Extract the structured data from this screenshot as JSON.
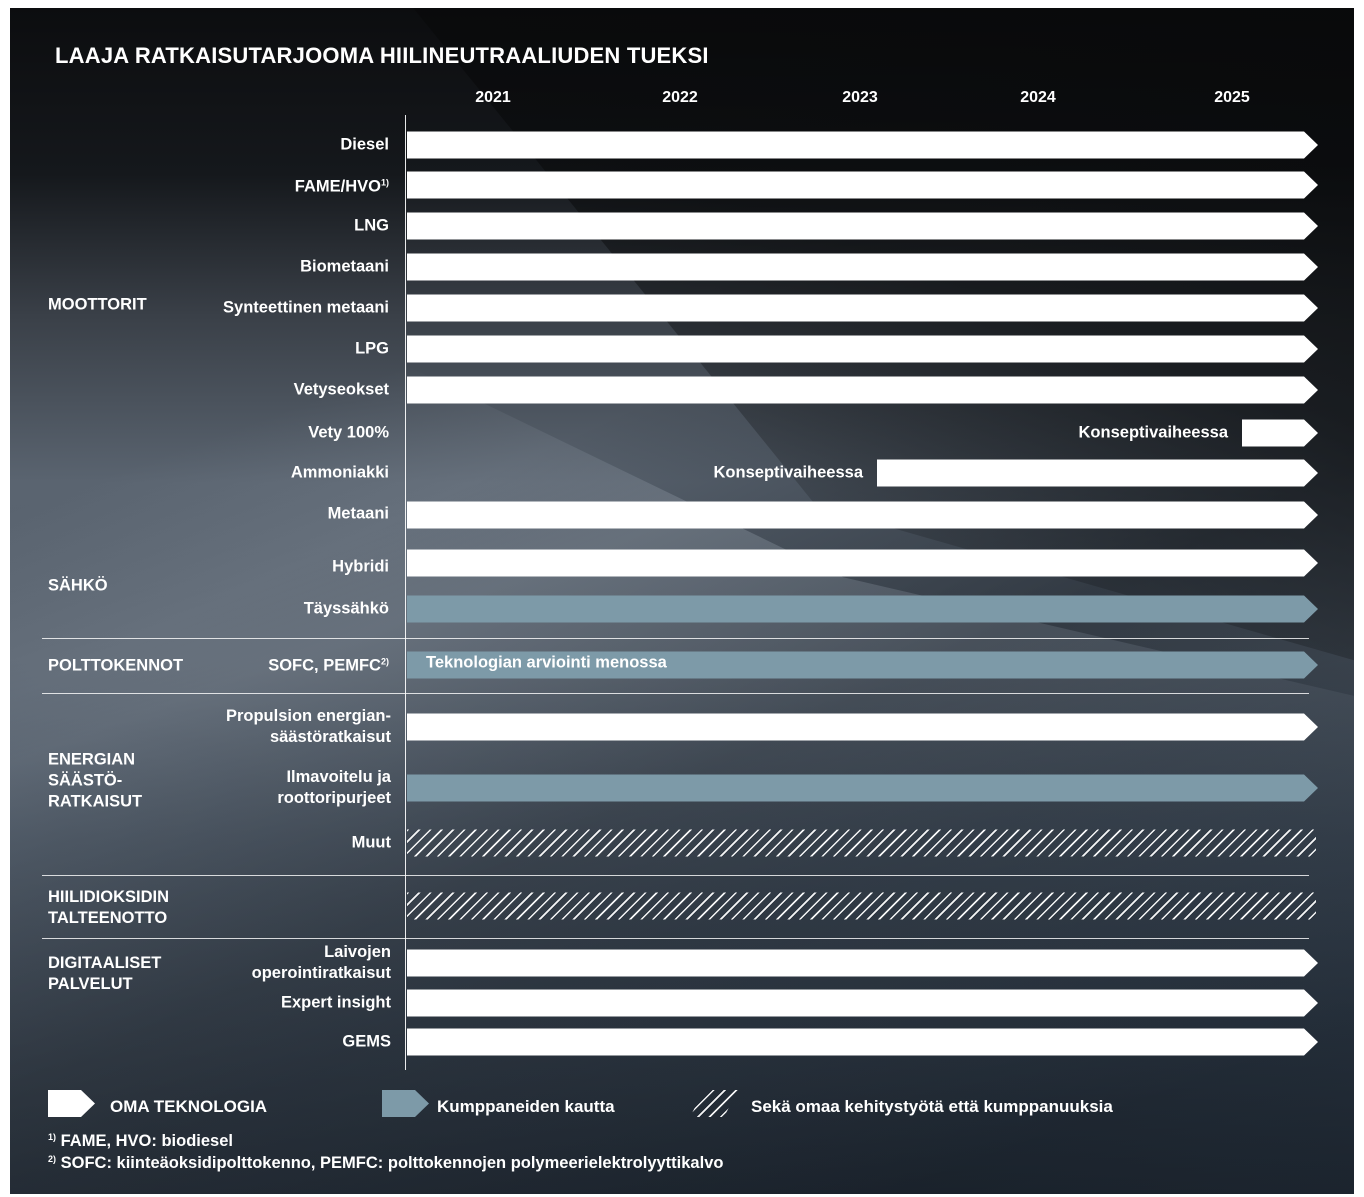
{
  "title": "LAAJA RATKAISUTARJOOMA HIILINEUTRAALIUDEN TUEKSI",
  "chart_data": {
    "type": "timeline",
    "years": [
      "2021",
      "2022",
      "2023",
      "2024",
      "2025"
    ],
    "rows": [
      {
        "id": "diesel",
        "label": "Diesel",
        "sup": "",
        "kind": "own",
        "start": 2020.5,
        "end": 2025.5,
        "bar_label": ""
      },
      {
        "id": "fame",
        "label": "FAME/HVO",
        "sup": "1)",
        "kind": "own",
        "start": 2020.5,
        "end": 2025.5,
        "bar_label": ""
      },
      {
        "id": "lng",
        "label": "LNG",
        "sup": "",
        "kind": "own",
        "start": 2020.5,
        "end": 2025.5,
        "bar_label": ""
      },
      {
        "id": "biomethane",
        "label": "Biometaani",
        "sup": "",
        "kind": "own",
        "start": 2020.5,
        "end": 2025.5,
        "bar_label": ""
      },
      {
        "id": "synmethane",
        "label": "Synteettinen metaani",
        "sup": "",
        "kind": "own",
        "start": 2020.5,
        "end": 2025.5,
        "bar_label": ""
      },
      {
        "id": "lpg",
        "label": "LPG",
        "sup": "",
        "kind": "own",
        "start": 2020.5,
        "end": 2025.5,
        "bar_label": ""
      },
      {
        "id": "h2blend",
        "label": "Vetyseokset",
        "sup": "",
        "kind": "own",
        "start": 2020.5,
        "end": 2025.5,
        "bar_label": ""
      },
      {
        "id": "h2full",
        "label": "Vety 100%",
        "sup": "",
        "kind": "own",
        "start": 2025.0,
        "end": 2025.5,
        "bar_label": "Konseptivaiheessa"
      },
      {
        "id": "ammonia",
        "label": "Ammoniakki",
        "sup": "",
        "kind": "own",
        "start": 2023.05,
        "end": 2025.5,
        "bar_label": "Konseptivaiheessa"
      },
      {
        "id": "methane",
        "label": "Metaani",
        "sup": "",
        "kind": "own",
        "start": 2020.5,
        "end": 2025.5,
        "bar_label": ""
      },
      {
        "id": "hybrid",
        "label": "Hybridi",
        "sup": "",
        "kind": "own",
        "start": 2020.5,
        "end": 2025.5,
        "bar_label": ""
      },
      {
        "id": "fullelec",
        "label": "Täyssähkö",
        "sup": "",
        "kind": "partner",
        "start": 2020.5,
        "end": 2025.5,
        "bar_label": ""
      },
      {
        "id": "sofc",
        "label": "SOFC, PEMFC",
        "sup": "2)",
        "kind": "partner",
        "start": 2020.5,
        "end": 2025.5,
        "bar_label": "Teknologian arviointi menossa"
      },
      {
        "id": "propulsion",
        "label": [
          "Propulsion energian-",
          "säästöratkaisut"
        ],
        "sup": "",
        "kind": "own",
        "start": 2020.5,
        "end": 2025.5,
        "bar_label": ""
      },
      {
        "id": "airlub",
        "label": [
          "Ilmavoitelu ja",
          "roottoripurjeet"
        ],
        "sup": "",
        "kind": "partner",
        "start": 2020.5,
        "end": 2025.5,
        "bar_label": ""
      },
      {
        "id": "other",
        "label": "Muut",
        "sup": "",
        "kind": "both",
        "start": 2020.5,
        "end": 2025.5,
        "bar_label": ""
      },
      {
        "id": "ccs",
        "label": "",
        "sup": "",
        "kind": "both",
        "start": 2020.5,
        "end": 2025.5,
        "bar_label": ""
      },
      {
        "id": "vesselops",
        "label": [
          "Laivojen",
          "operointiratkaisut"
        ],
        "sup": "",
        "kind": "own",
        "start": 2020.5,
        "end": 2025.5,
        "bar_label": ""
      },
      {
        "id": "expert",
        "label": "Expert insight",
        "sup": "",
        "kind": "own",
        "start": 2020.5,
        "end": 2025.5,
        "bar_label": ""
      },
      {
        "id": "gems",
        "label": "GEMS",
        "sup": "",
        "kind": "own",
        "start": 2020.5,
        "end": 2025.5,
        "bar_label": ""
      }
    ],
    "groups": [
      {
        "id": "engines",
        "label": [
          "MOOTTORIT"
        ]
      },
      {
        "id": "electric",
        "label": [
          "SÄHKÖ"
        ]
      },
      {
        "id": "fuelcells",
        "label": [
          "POLTTOKENNOT"
        ]
      },
      {
        "id": "energysaving",
        "label": [
          "ENERGIAN",
          "SÄÄSTÖ-",
          "RATKAISUT"
        ]
      },
      {
        "id": "ccs",
        "label": [
          "HIILIDIOKSIDIN",
          "TALTEENOTTO"
        ]
      },
      {
        "id": "digital",
        "label": [
          "DIGITAALISET",
          "PALVELUT"
        ]
      }
    ]
  },
  "legend": {
    "own": "OMA TEKNOLOGIA",
    "partner": "Kumppaneiden kautta",
    "both": "Sekä omaa kehitystyötä että kumppanuuksia"
  },
  "footnotes": {
    "note1_marker": "1)",
    "note1_text": "FAME, HVO: biodiesel",
    "note2_marker": "2)",
    "note2_text": "SOFC: kiinteäoksidipolttokenno, PEMFC: polttokennojen polymeerielektrolyyttikalvo"
  },
  "colors": {
    "own": "#ffffff",
    "partner": "#7d9aa8",
    "text": "#ffffff"
  }
}
